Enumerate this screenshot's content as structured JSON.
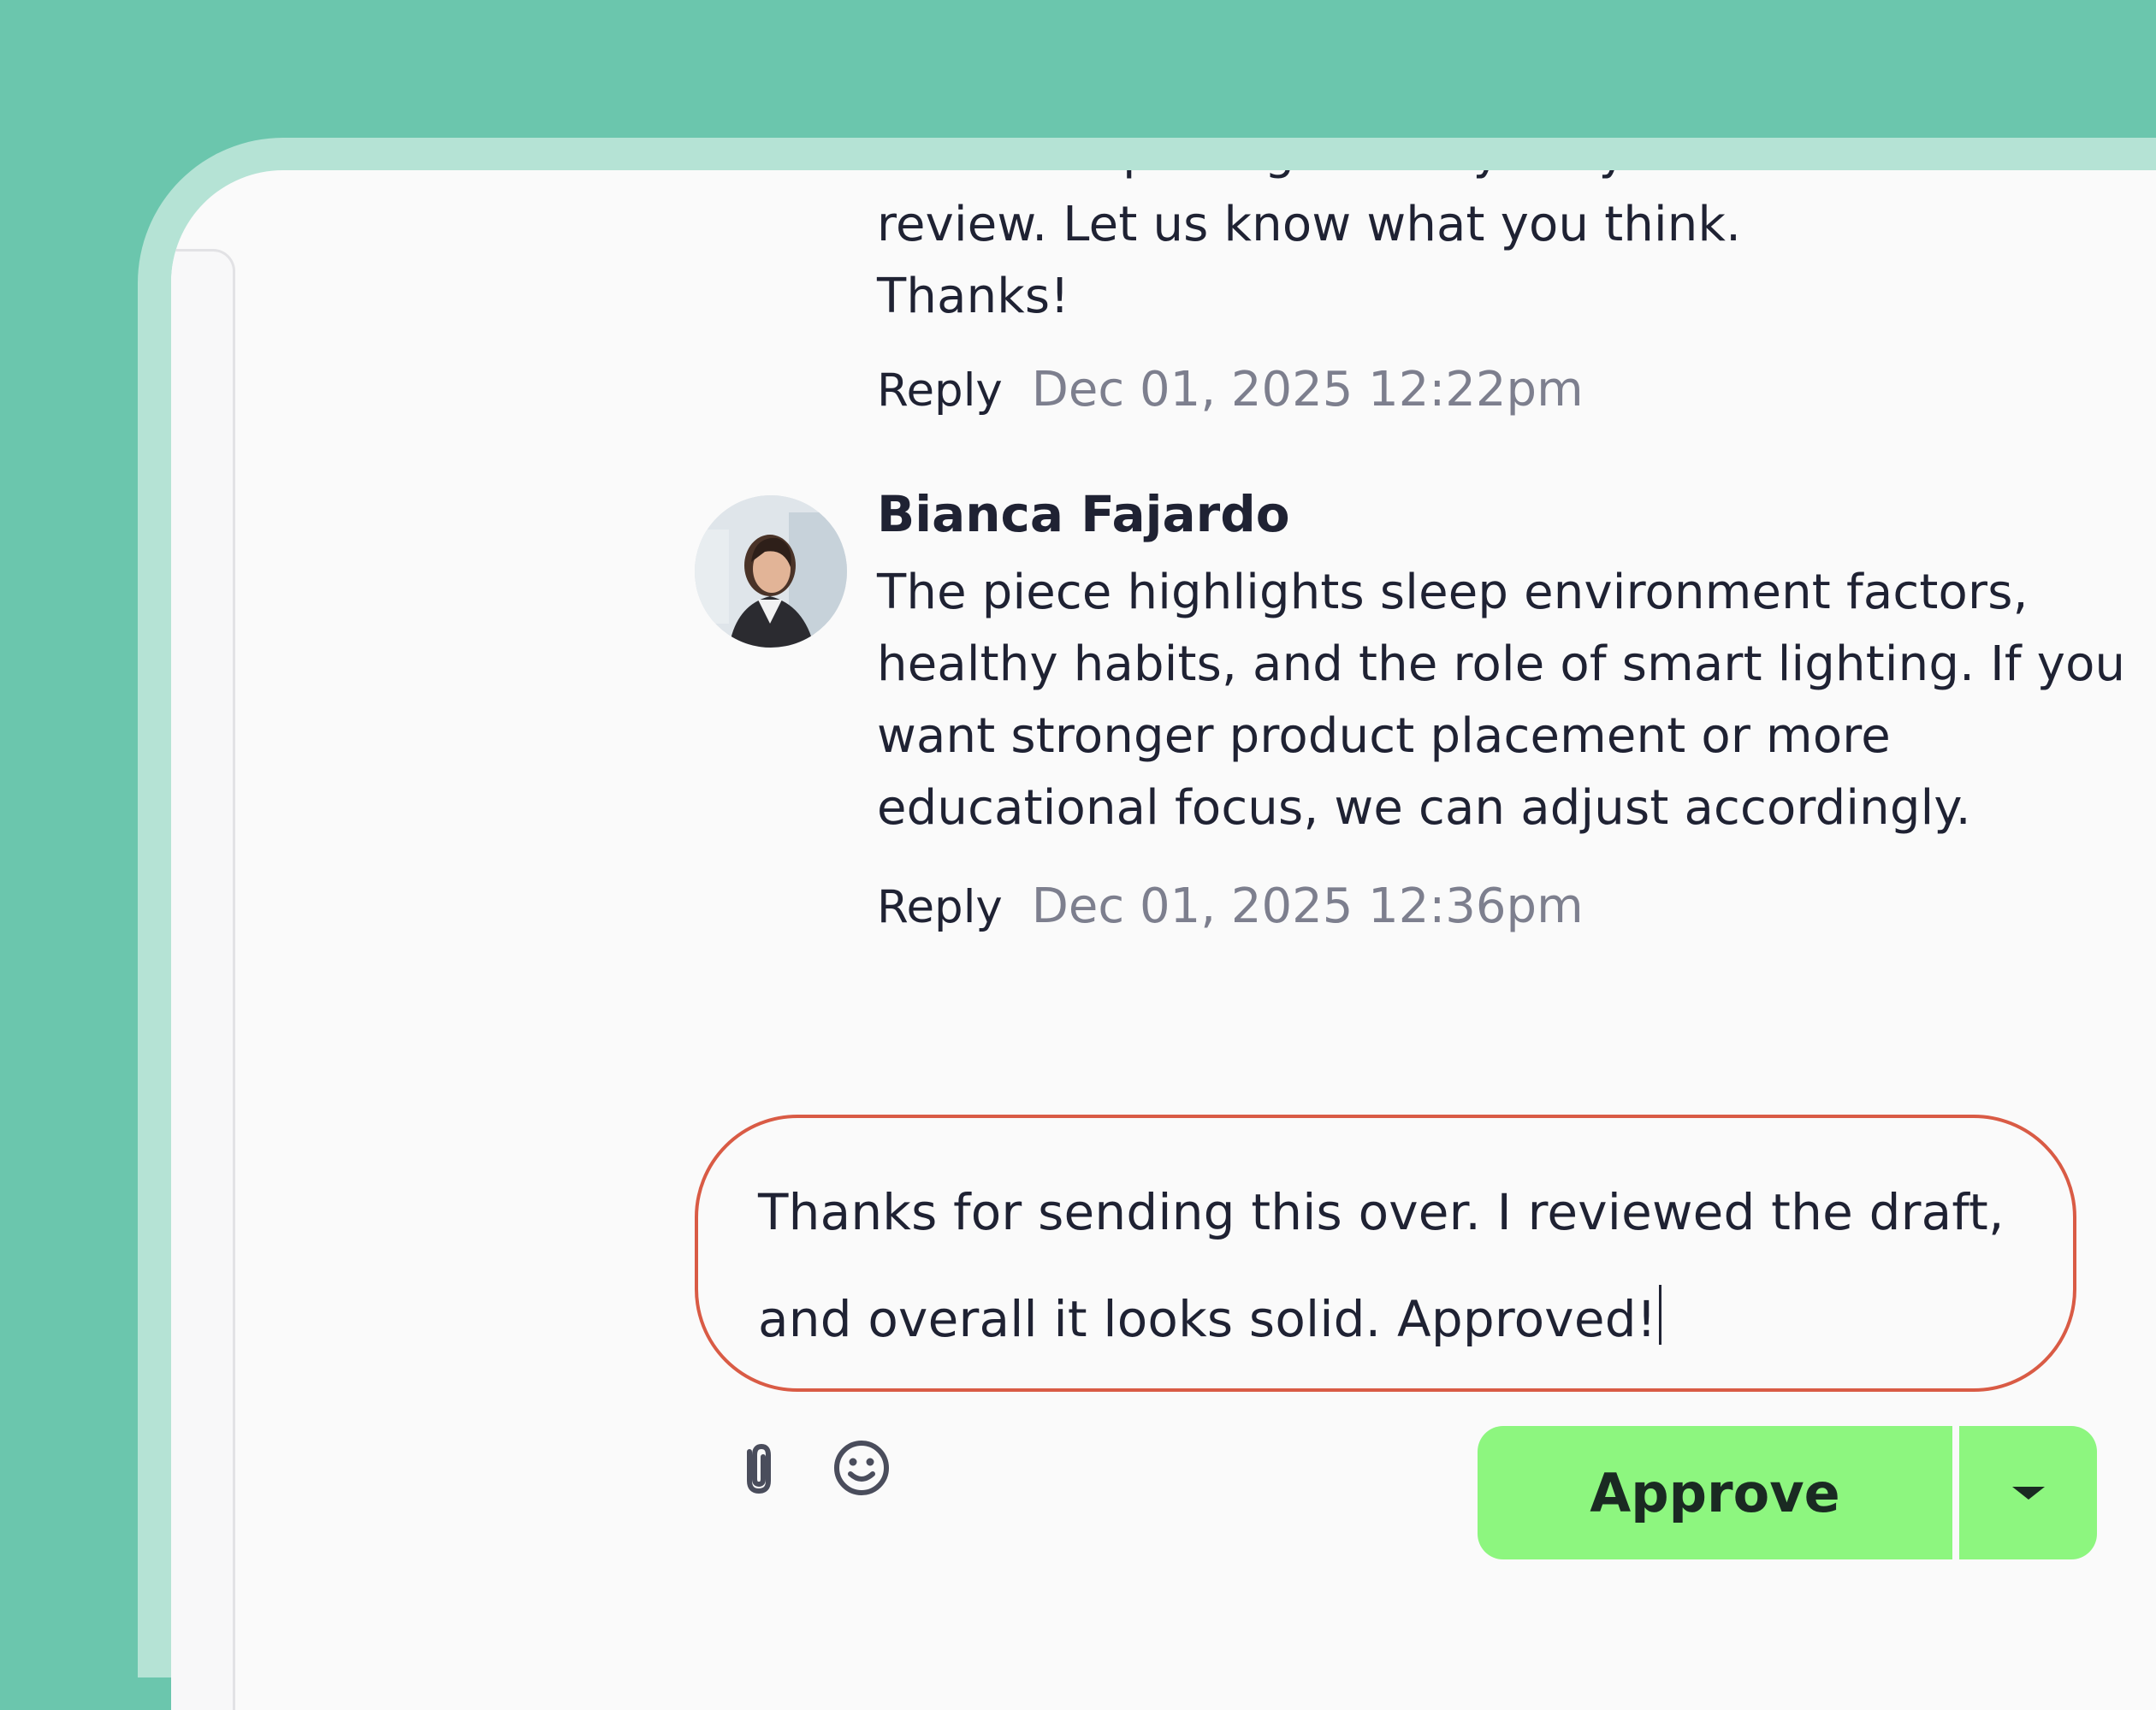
{
  "thread": {
    "first_comment": {
      "body_partial_top": "Good Sleep\" blog is ready for your",
      "body_lines": [
        "review. Let us know what you think.",
        "Thanks!"
      ],
      "reply_label": "Reply",
      "timestamp": "Dec 01, 2025 12:22pm"
    },
    "second_comment": {
      "author": "Bianca Fajardo",
      "body": "The piece highlights sleep environment factors, healthy habits, and the role of smart lighting. If you want stronger product placement or more educational focus, we can adjust accordingly.",
      "reply_label": "Reply",
      "timestamp": "Dec 01, 2025 12:36pm"
    }
  },
  "composer": {
    "value": "Thanks for sending this over. I reviewed the draft, and overall it looks solid. Approved!"
  },
  "toolbar": {
    "attach_icon": "paperclip-icon",
    "emoji_icon": "smiley-icon",
    "approve_label": "Approve",
    "approve_color": "#8df67f"
  },
  "colors": {
    "background": "#6bc6ad",
    "frame": "#b5e3d5",
    "composer_border": "#d95b45",
    "timestamp": "#7d7f8e"
  }
}
